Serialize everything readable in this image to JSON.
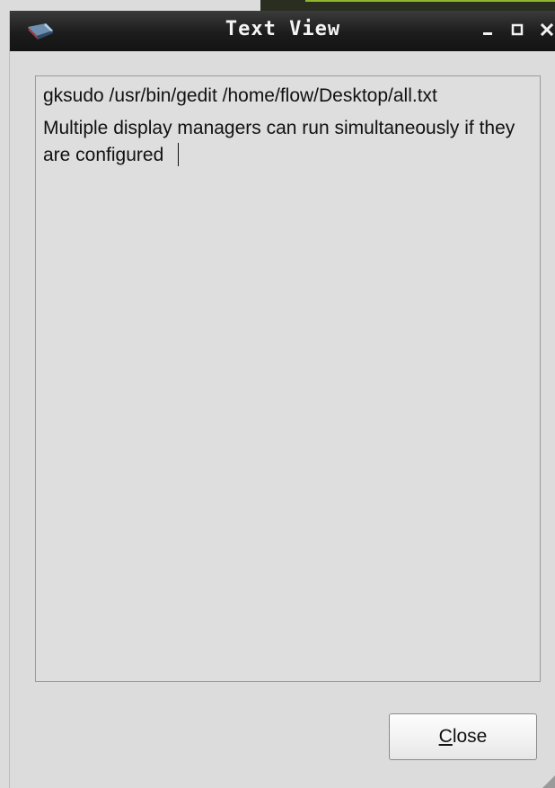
{
  "window": {
    "title": "Text View",
    "icon": "app-icon"
  },
  "window_controls": {
    "minimize_icon": "minimize-icon",
    "maximize_icon": "maximize-icon",
    "close_icon": "close-icon"
  },
  "text_view": {
    "lines": [
      "gksudo /usr/bin/gedit /home/flow/Desktop/all.txt",
      "Multiple display managers can run simultaneously if they are configured"
    ]
  },
  "close_button": {
    "mnemonic": "C",
    "rest": "lose"
  },
  "colors": {
    "titlebar": "#1c1c1c",
    "title_text": "#f4f4f4",
    "window_bg": "#dcdcdc",
    "text_area_bg": "#dedede",
    "text_area_border": "#9a9a9a",
    "desktop_accent": "#8fb52c"
  }
}
